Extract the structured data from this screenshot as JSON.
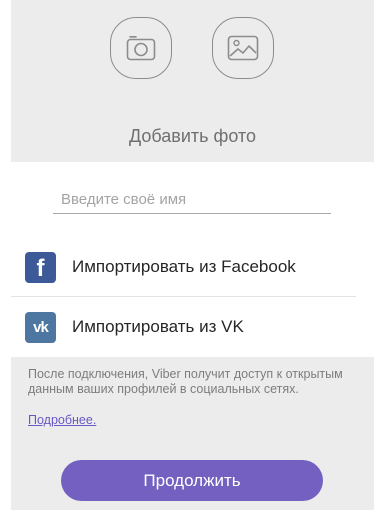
{
  "photo": {
    "camera_icon": "camera-icon",
    "gallery_icon": "image-icon",
    "label": "Добавить фото"
  },
  "name_input": {
    "placeholder": "Введите своё имя",
    "value": ""
  },
  "imports": {
    "facebook": {
      "icon": "facebook-icon",
      "glyph": "f",
      "label": "Импортировать из Facebook"
    },
    "vk": {
      "icon": "vk-icon",
      "glyph": "vk",
      "label": "Импортировать из VK"
    }
  },
  "info": {
    "text": "После подключения, Viber получит доступ к открытым данным ваших профилей в социальных сетях.",
    "link": "Подробнее."
  },
  "continue_button": {
    "label": "Продолжить"
  },
  "colors": {
    "accent": "#7360c0",
    "facebook": "#3c5a98",
    "vk": "#4d76a1",
    "background_gray": "#ececec"
  }
}
